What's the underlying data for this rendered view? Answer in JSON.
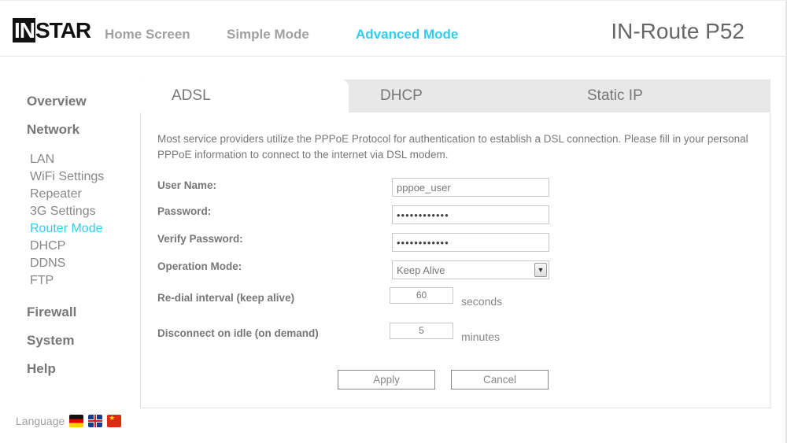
{
  "header": {
    "logo": {
      "part1": "IN",
      "part2": "STAR"
    },
    "nav": [
      "Home Screen",
      "Simple Mode",
      "Advanced Mode"
    ],
    "active_nav": "Advanced Mode",
    "product": "IN-Route P52"
  },
  "sidebar": {
    "overview": "Overview",
    "network": "Network",
    "network_items": [
      "LAN",
      "WiFi Settings",
      "Repeater",
      "3G Settings",
      "Router Mode",
      "DHCP",
      "DDNS",
      "FTP"
    ],
    "active_item": "Router Mode",
    "firewall": "Firewall",
    "system": "System",
    "help": "Help"
  },
  "language": {
    "label": "Language",
    "flags": [
      "de-flag",
      "uk-flag",
      "cn-flag"
    ]
  },
  "tabs": [
    "ADSL",
    "DHCP",
    "Static IP"
  ],
  "active_tab": "ADSL",
  "form": {
    "intro": "Most service providers utilize the PPPoE Protocol for authentication to establish a DSL connection. Please fill in your personal PPPoE information to connect to the internet via DSL modem.",
    "user_name_label": "User Name:",
    "user_name_value": "pppoe_user",
    "password_label": "Password:",
    "password_value": "••••••••••••",
    "verify_label": "Verify Password:",
    "verify_value": "••••••••••••",
    "operation_label": "Operation Mode:",
    "operation_value": "Keep Alive",
    "redial_label": "Re-dial interval (keep alive)",
    "redial_value": "60",
    "redial_unit": "seconds",
    "disconnect_label": "Disconnect on idle (on demand)",
    "disconnect_value": "5",
    "disconnect_unit": "minutes",
    "apply": "Apply",
    "cancel": "Cancel"
  },
  "colors": {
    "accent": "#33ccee",
    "text": "#777777",
    "tab_bar": "#e8e8e8"
  }
}
